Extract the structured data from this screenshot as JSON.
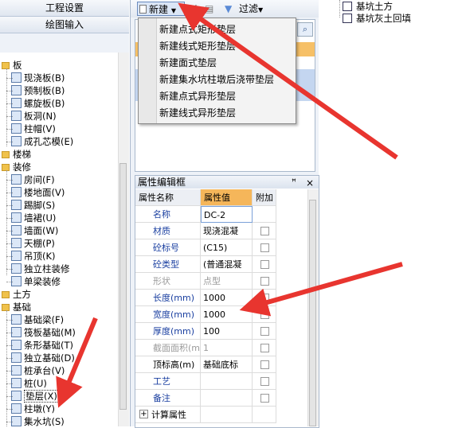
{
  "left_panel": {
    "tabs": [
      "工程设置",
      "绘图输入"
    ],
    "tree": [
      {
        "label": "板",
        "level": 0
      },
      {
        "label": "现浇板(B)",
        "level": 1
      },
      {
        "label": "预制板(B)",
        "level": 1
      },
      {
        "label": "螺旋板(B)",
        "level": 1
      },
      {
        "label": "板洞(N)",
        "level": 1
      },
      {
        "label": "柱帽(V)",
        "level": 1
      },
      {
        "label": "成孔芯模(E)",
        "level": 1
      },
      {
        "label": "楼梯",
        "level": 0
      },
      {
        "label": "装修",
        "level": 0
      },
      {
        "label": "房间(F)",
        "level": 1
      },
      {
        "label": "楼地面(V)",
        "level": 1
      },
      {
        "label": "踢脚(S)",
        "level": 1
      },
      {
        "label": "墙裙(U)",
        "level": 1
      },
      {
        "label": "墙面(W)",
        "level": 1
      },
      {
        "label": "天棚(P)",
        "level": 1
      },
      {
        "label": "吊顶(K)",
        "level": 1
      },
      {
        "label": "独立柱装修",
        "level": 1
      },
      {
        "label": "单梁装修",
        "level": 1
      },
      {
        "label": "土方",
        "level": 0
      },
      {
        "label": "基础",
        "level": 0
      },
      {
        "label": "基础梁(F)",
        "level": 1
      },
      {
        "label": "筏板基础(M)",
        "level": 1
      },
      {
        "label": "条形基础(T)",
        "level": 1
      },
      {
        "label": "独立基础(D)",
        "level": 1
      },
      {
        "label": "桩承台(V)",
        "level": 1
      },
      {
        "label": "桩(U)",
        "level": 1
      },
      {
        "label": "垫层(X)",
        "level": 1,
        "selected": true
      },
      {
        "label": "柱墩(Y)",
        "level": 1
      },
      {
        "label": "集水坑(S)",
        "level": 1
      }
    ]
  },
  "toolbar": {
    "new_label": "新建",
    "filter_label": "过滤"
  },
  "new_menu": {
    "items": [
      "新建点式矩形垫层",
      "新建线式矩形垫层",
      "新建面式垫层",
      "新建集水坑柱墩后浇带垫层",
      "新建点式异形垫层",
      "新建线式异形垫层"
    ]
  },
  "property_panel": {
    "title": "属性编辑框",
    "pin": "ᵖ",
    "close": "×",
    "headers": {
      "name": "属性名称",
      "value": "属性值",
      "add": "附加"
    },
    "rows": [
      {
        "name": "名称",
        "value": "DC-2",
        "style": "blue",
        "checkbox": false
      },
      {
        "name": "材质",
        "value": "现浇混凝",
        "style": "blue",
        "checkbox": true
      },
      {
        "name": "砼标号",
        "value": "(C15)",
        "style": "blue",
        "checkbox": true
      },
      {
        "name": "砼类型",
        "value": "(普通混凝",
        "style": "blue",
        "checkbox": true
      },
      {
        "name": "形状",
        "value": "点型",
        "style": "gray",
        "checkbox": true
      },
      {
        "name": "长度(mm)",
        "value": "1000",
        "style": "blue",
        "checkbox": true
      },
      {
        "name": "宽度(mm)",
        "value": "1000",
        "style": "blue",
        "checkbox": true
      },
      {
        "name": "厚度(mm)",
        "value": "100",
        "style": "blue",
        "checkbox": true
      },
      {
        "name": "截面面积(m",
        "value": "1",
        "style": "gray",
        "checkbox": true
      },
      {
        "name": "顶标高(m)",
        "value": "基础底标",
        "style": "black",
        "checkbox": true
      },
      {
        "name": "工艺",
        "value": "",
        "style": "blue",
        "checkbox": true
      },
      {
        "name": "备注",
        "value": "",
        "style": "blue",
        "checkbox": true
      },
      {
        "name": "计算属性",
        "value": "",
        "style": "group",
        "checkbox": false
      }
    ]
  },
  "right_tree": {
    "items": [
      "基坑土方",
      "基坑灰土回填"
    ]
  },
  "colors": {
    "highlight_orange": "#f6c067",
    "arrow_red": "#e8352f",
    "header_value_orange": "#f5b65a"
  }
}
